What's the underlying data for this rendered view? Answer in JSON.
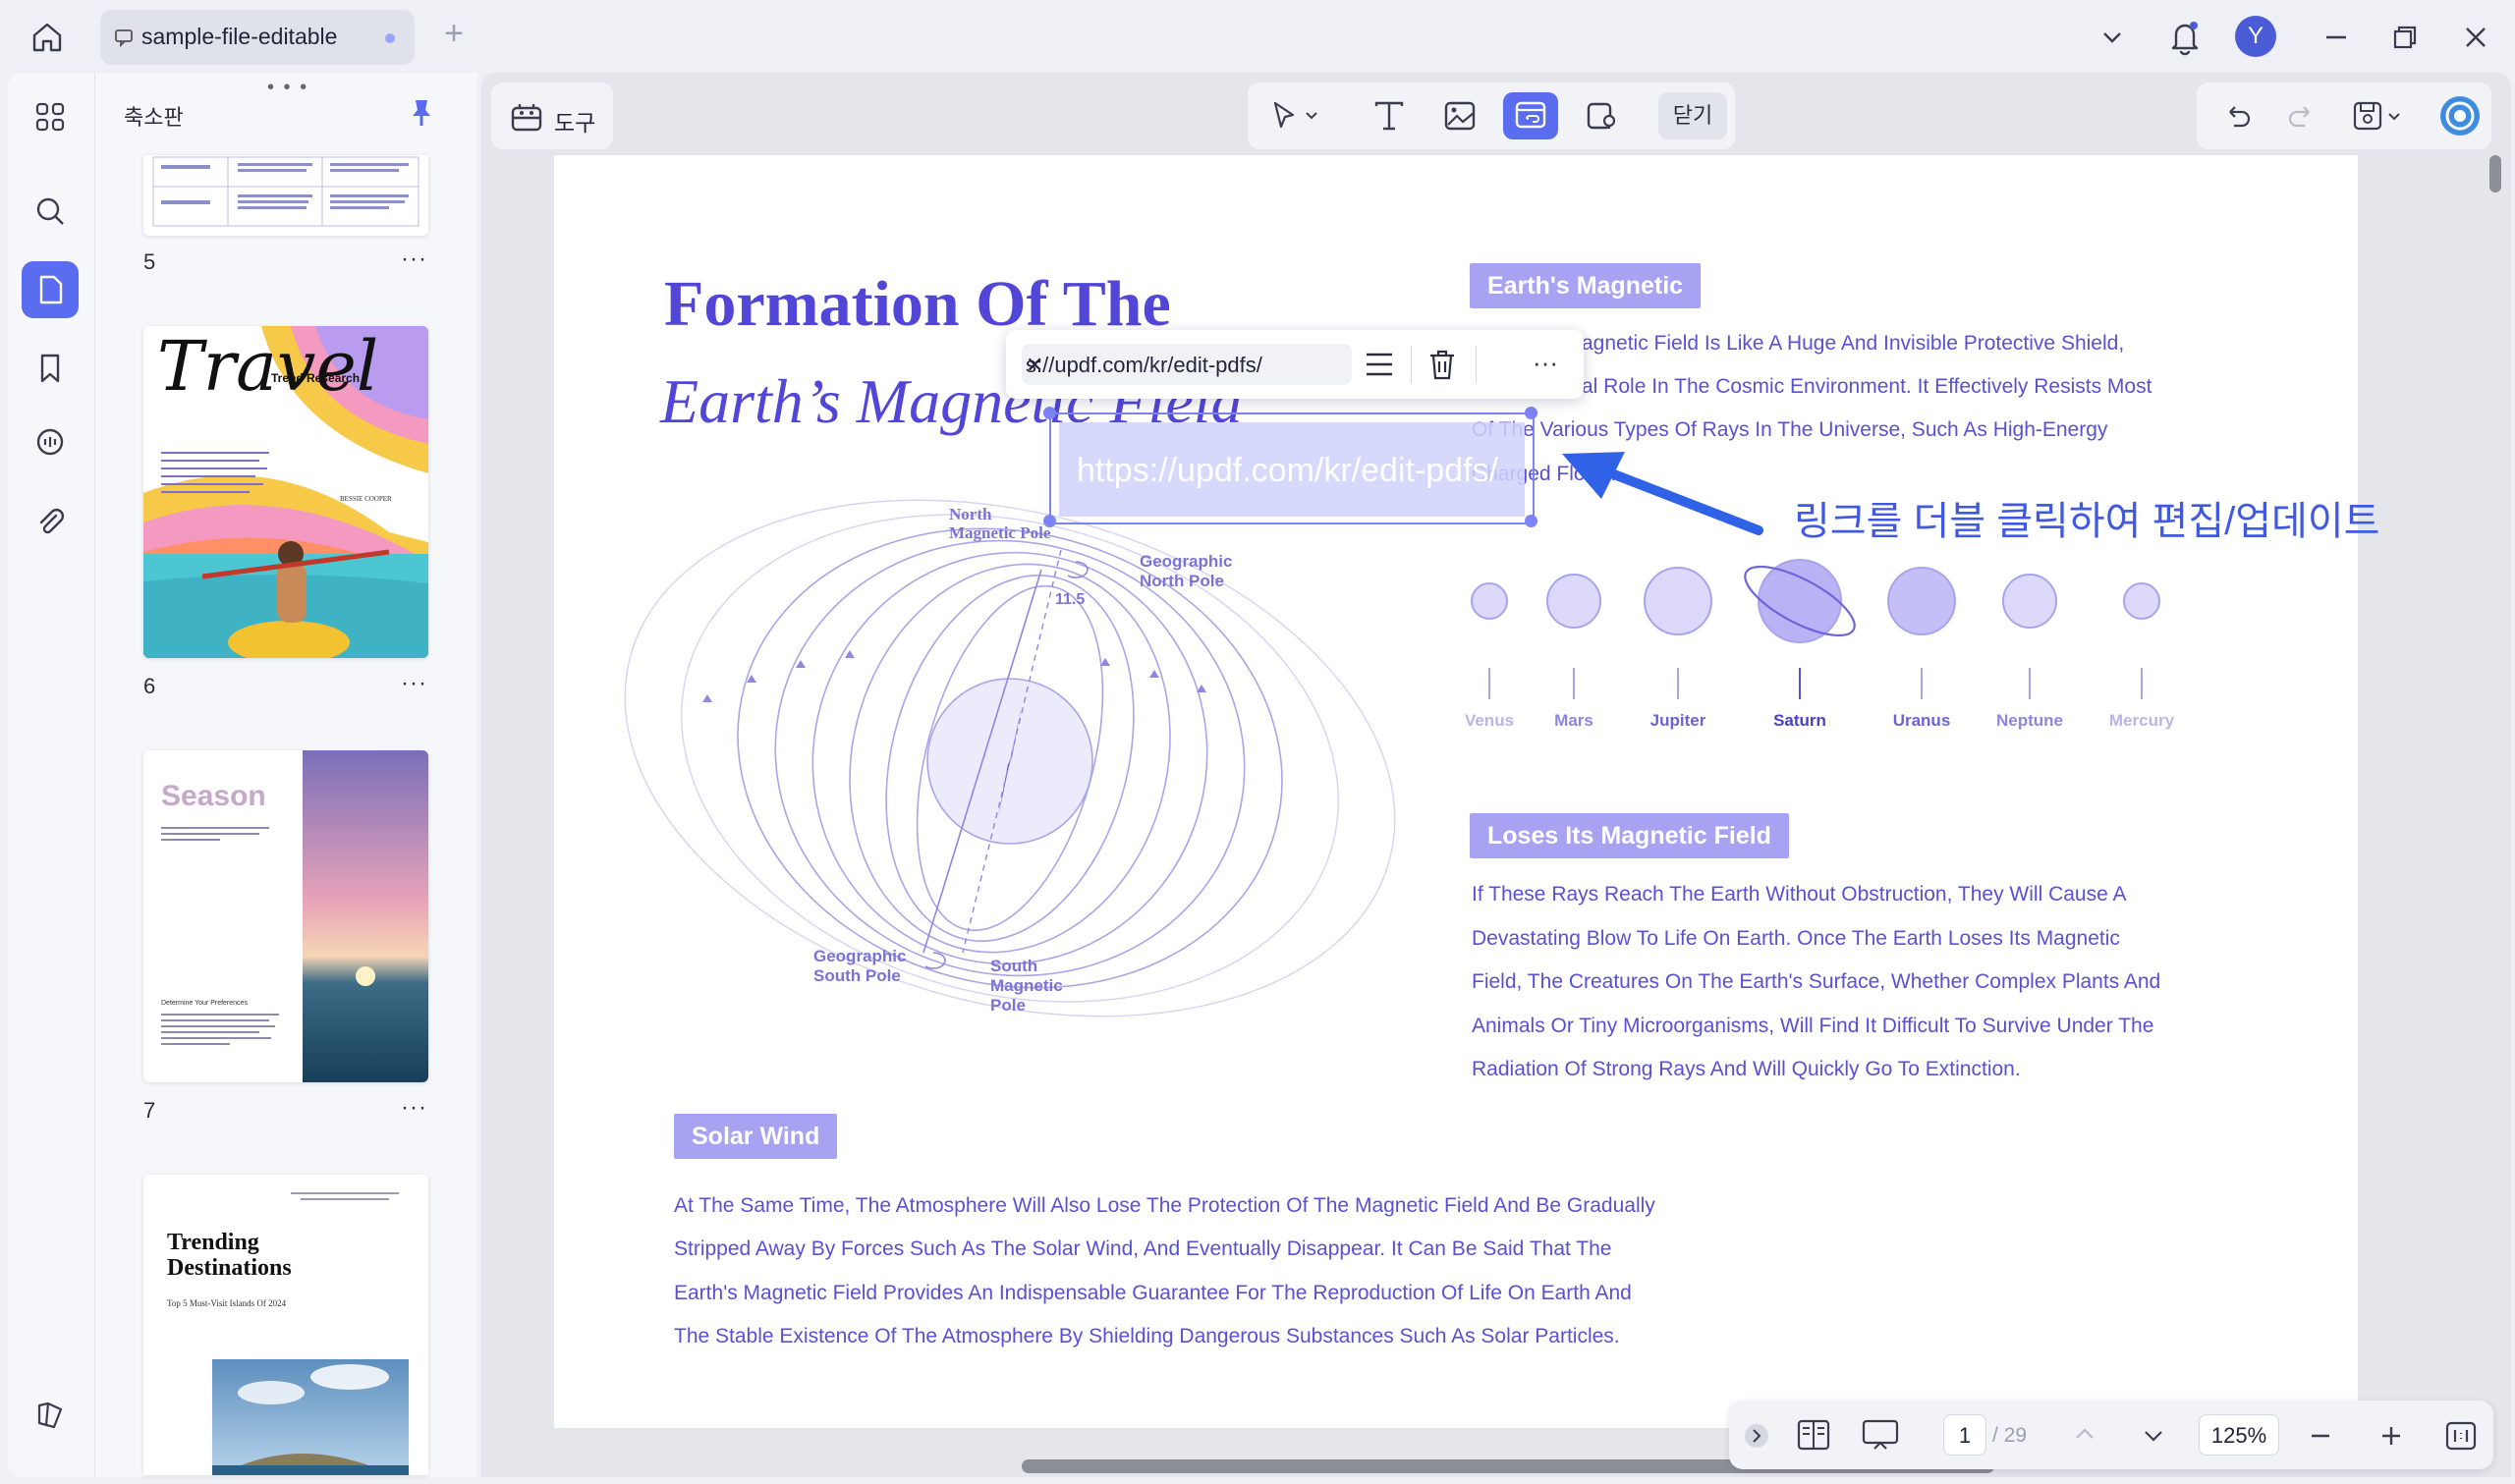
{
  "tab": {
    "title": "sample-file-editable"
  },
  "user": {
    "initial": "Y"
  },
  "left_panel": {
    "title": "축소판",
    "pages": [
      {
        "number": "5"
      },
      {
        "number": "6",
        "cover_title": "Travel",
        "cover_subtitle": "Trend Research",
        "cover_author": "BESSIE COOPER"
      },
      {
        "number": "7",
        "cover_title": "Season",
        "cover_heading": "Determine Your Preferences"
      },
      {
        "number": "",
        "cover_title_1": "Trending",
        "cover_title_2": "Destinations",
        "cover_subtitle": "Top 5 Must-Visit Islands Of 2024"
      }
    ]
  },
  "toolbar": {
    "tools_label": "도구",
    "close_label": "닫기"
  },
  "document": {
    "title_line1": "Formation Of The",
    "title_line2": "Earth’s Magnetic Field",
    "section1": {
      "tag": "Earth's Magnetic",
      "lines": [
        "agnetic Field Is Like A Huge And Invisible Protective Shield,",
        "al Role In The Cosmic Environment. It Effectively Resists Most",
        "Of The Various Types Of Rays In The Universe, Such As High-Energy",
        "Charged          Flows."
      ]
    },
    "planets": [
      "Venus",
      "Mars",
      "Jupiter",
      "Saturn",
      "Uranus",
      "Neptune",
      "Mercury"
    ],
    "diagram_labels": {
      "north_magnetic": "North Magnetic Pole",
      "geographic_north": "Geographic North Pole",
      "angle": "11.5",
      "geographic_south": "Geographic South Pole",
      "south_magnetic": "South Magnetic Pole"
    },
    "section2": {
      "tag": "Loses Its Magnetic Field",
      "lines": [
        "If These Rays Reach The Earth Without Obstruction, They Will Cause A",
        "Devastating Blow To Life On Earth. Once The Earth Loses Its Magnetic",
        "Field, The Creatures On The Earth's Surface, Whether Complex Plants And",
        "Animals Or Tiny Microorganisms, Will Find It Difficult To Survive Under The",
        "Radiation Of Strong Rays And Will Quickly Go To Extinction."
      ]
    },
    "section3": {
      "tag": "Solar Wind",
      "lines": [
        "At The Same Time, The Atmosphere Will Also Lose The Protection Of The Magnetic Field And Be Gradually",
        "Stripped Away By Forces Such As The Solar Wind, And Eventually Disappear. It Can Be Said That The",
        "Earth's Magnetic Field Provides An Indispensable Guarantee For The Reproduction Of Life On Earth And",
        "The Stable Existence Of The Atmosphere By Shielding Dangerous Substances Such As Solar Particles."
      ]
    }
  },
  "link": {
    "url_field": "s://updf.com/kr/edit-pdfs/",
    "url_display": "https://updf.com/kr/edit-pdfs/"
  },
  "annotation": "링크를 더블 클릭하여 편집/업데이트",
  "bottom_bar": {
    "current_page": "1",
    "total_pages": "/ 29",
    "zoom": "125%"
  },
  "colors": {
    "accent": "#5a6cf0",
    "doc_purple": "#5246d8",
    "tag_bg": "#a8a2f2",
    "annotation": "#4059e0"
  }
}
